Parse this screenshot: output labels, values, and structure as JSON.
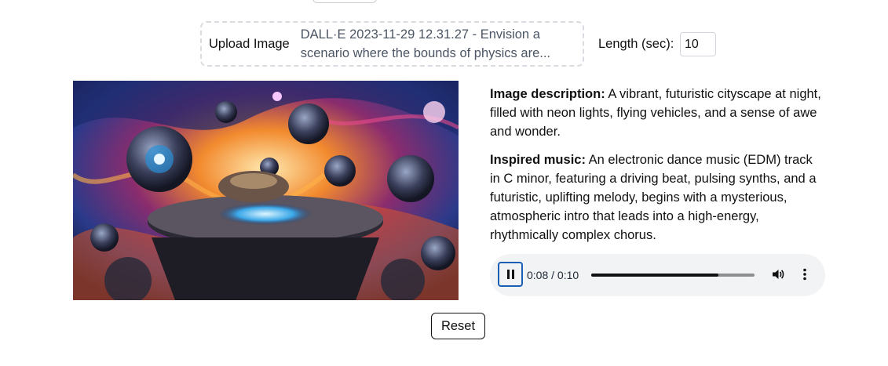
{
  "upload": {
    "button_label": "Upload Image",
    "file_name": "DALL·E 2023-11-29 12.31.27 - Envision a scenario where the bounds of physics are..."
  },
  "length": {
    "label": "Length (sec):",
    "value": "10"
  },
  "artwork": {
    "alt": "DALL·E 2023-11-29 12.31.27 - Envision a scenario where the bounds of physics are"
  },
  "description": {
    "image_label": "Image description:",
    "image_text": " A vibrant, futuristic cityscape at night, filled with neon lights, flying vehicles, and a sense of awe and wonder.",
    "music_label": "Inspired music:",
    "music_text": " An electronic dance music (EDM) track in C minor, featuring a driving beat, pulsing synths, and a futuristic, uplifting melody, begins with a mysterious, atmospheric intro that leads into a high-energy, rhythmically complex chorus."
  },
  "player": {
    "time": "0:08 / 0:10",
    "progress": 0.78,
    "icons": [
      "pause-icon",
      "volume-icon",
      "more-options-icon"
    ]
  },
  "reset": {
    "label": "Reset"
  }
}
